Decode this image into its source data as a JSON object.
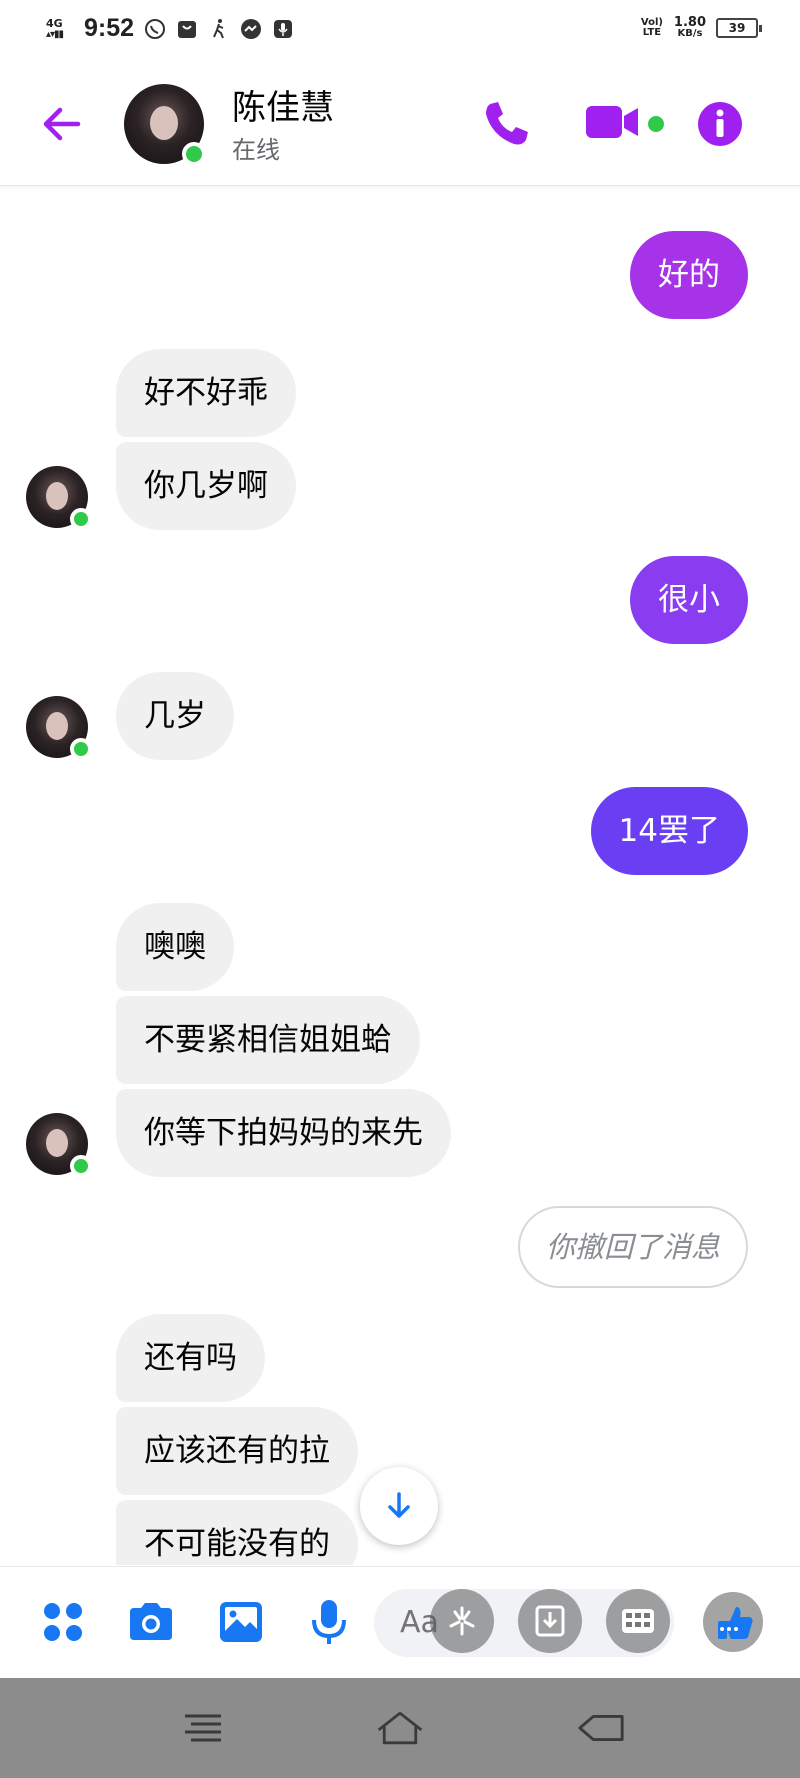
{
  "status_bar": {
    "network": "4G",
    "time": "9:52",
    "volte": "Vol) LTE",
    "speed_value": "1.80",
    "speed_unit": "KB/s",
    "battery": "39"
  },
  "header": {
    "contact_name": "陈佳慧",
    "contact_status": "在线",
    "accent_color": "#a020f0",
    "online_color": "#31c94a"
  },
  "messages": [
    {
      "id": "m1",
      "direction": "out",
      "text": "好的",
      "color": "#a633e8"
    },
    {
      "id": "m2",
      "direction": "in",
      "text": "好不好乖"
    },
    {
      "id": "m3",
      "direction": "in",
      "text": "你几岁啊"
    },
    {
      "id": "m4",
      "direction": "out",
      "text": "很小",
      "color": "#8a3df0"
    },
    {
      "id": "m5",
      "direction": "in",
      "text": "几岁"
    },
    {
      "id": "m6",
      "direction": "out",
      "text": "14罢了",
      "color": "#6a3ff3"
    },
    {
      "id": "m7",
      "direction": "in",
      "text": "噢噢"
    },
    {
      "id": "m8",
      "direction": "in",
      "text": "不要紧相信姐姐蛤"
    },
    {
      "id": "m9",
      "direction": "in",
      "text": "你等下拍妈妈的来先"
    },
    {
      "id": "m10",
      "direction": "system",
      "text": "你撤回了消息"
    },
    {
      "id": "m11",
      "direction": "in",
      "text": "还有吗"
    },
    {
      "id": "m12",
      "direction": "in",
      "text": "应该还有的拉"
    },
    {
      "id": "m13",
      "direction": "in",
      "text": "不可能没有的"
    }
  ],
  "composer": {
    "placeholder": "Aa",
    "icon_color": "#1877f2"
  },
  "icons": {
    "back": "back-arrow-icon",
    "call": "phone-icon",
    "video": "video-camera-icon",
    "info": "info-icon",
    "menu": "four-dots-icon",
    "camera": "camera-icon",
    "gallery": "image-icon",
    "mic": "microphone-icon",
    "like": "thumbs-up-icon",
    "scroll": "arrow-down-icon"
  }
}
